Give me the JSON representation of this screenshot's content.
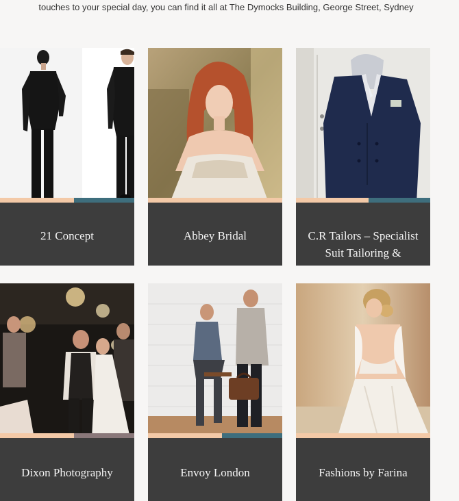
{
  "intro_text": "touches to your special day, you can find it all at The Dymocks Building, George Street, Sydney",
  "colors": {
    "card_info_bg": "#3d3d3d",
    "accent_peach": "#f3c9a7",
    "accent_teal": "#3e6e7d",
    "accent_mauve": "#8a787a",
    "page_bg": "#f7f6f5"
  },
  "vendors": [
    {
      "name": "21 Concept",
      "image": "black-suits-photo",
      "accent": [
        "#f3c9a7",
        "#3e6e7d"
      ]
    },
    {
      "name": "Abbey Bridal",
      "image": "bride-lace-gown-photo",
      "accent": [
        "#f3c9a7",
        "#f3c9a7"
      ]
    },
    {
      "name": "C.R Tailors – Specialist Suit Tailoring & Alterations",
      "image": "navy-blazer-photo",
      "accent": [
        "#f3c9a7",
        "#3e6e7d"
      ]
    },
    {
      "name": "Dixon Photography",
      "image": "sparkler-wedding-photo",
      "accent": [
        "#f3c9a7",
        "#8a787a"
      ]
    },
    {
      "name": "Envoy London",
      "image": "mens-suits-studio-photo",
      "accent": [
        "#f3c9a7",
        "#3e6e7d"
      ]
    },
    {
      "name": "Fashions by Farina",
      "image": "lace-back-gown-photo",
      "accent": [
        "#f3c9a7",
        "#f3c9a7"
      ]
    }
  ]
}
